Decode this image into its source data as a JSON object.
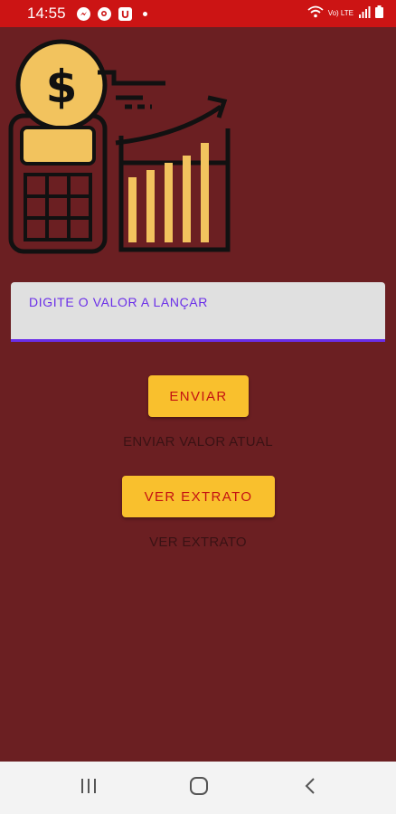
{
  "status_bar": {
    "time": "14:55",
    "notification_icons": [
      "messenger-icon",
      "github-icon",
      "u-app-icon"
    ],
    "network_label": "Vo) LTE",
    "right_icons": [
      "wifi-icon",
      "signal-icon",
      "battery-icon"
    ]
  },
  "hero": {
    "icon": "money-calculator-growth-icon"
  },
  "value_input": {
    "value": "",
    "placeholder": "DIGITE O VALOR A LANÇAR"
  },
  "send_button": {
    "label": "ENVIAR"
  },
  "send_caption": "ENVIAR VALOR ATUAL",
  "extract_button": {
    "label": "VER EXTRATO"
  },
  "extract_caption": "VER EXTRATO",
  "nav_bar": {
    "buttons": [
      "recents-icon",
      "home-icon",
      "back-icon"
    ]
  },
  "colors": {
    "background": "#6b1f22",
    "status_bar": "#cc1414",
    "button_bg": "#f9c02d",
    "button_text": "#c41212",
    "input_accent": "#6a2ee8"
  }
}
